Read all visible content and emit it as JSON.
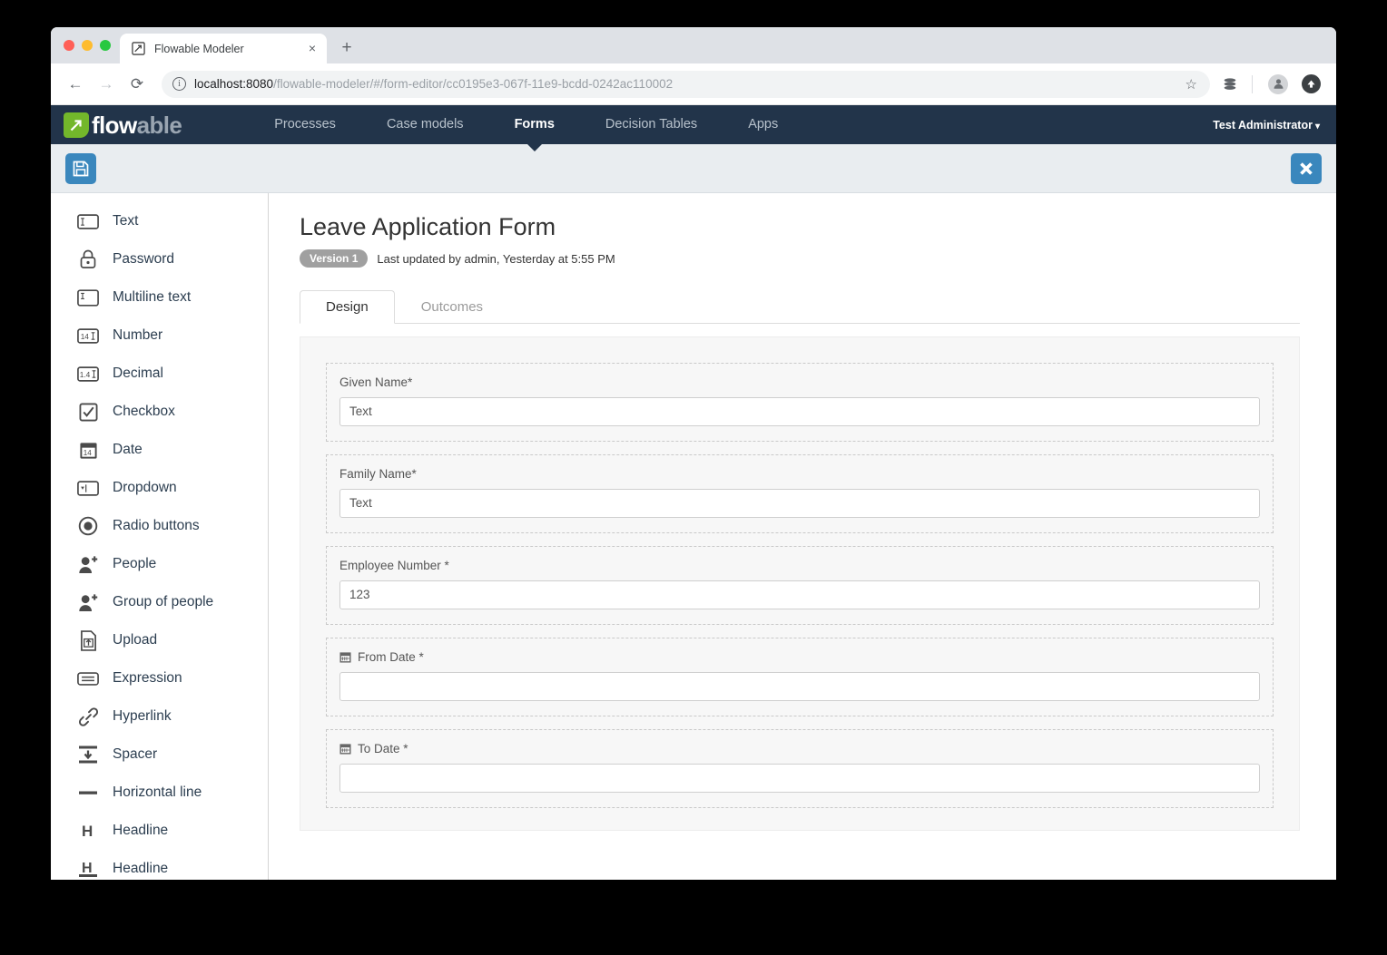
{
  "browser": {
    "tab_title": "Flowable Modeler",
    "tab_close_label": "×",
    "new_tab_label": "+",
    "back_label": "←",
    "forward_label": "→",
    "reload_label": "⟳",
    "url_host": "localhost:8080",
    "url_path": "/flowable-modeler/#/form-editor/cc0195e3-067f-11e9-bcdd-0242ac110002",
    "star_label": "☆"
  },
  "navbar": {
    "logo_text_primary": "flow",
    "logo_text_secondary": "able",
    "items": [
      {
        "label": "Processes",
        "active": false
      },
      {
        "label": "Case models",
        "active": false
      },
      {
        "label": "Forms",
        "active": true
      },
      {
        "label": "Decision Tables",
        "active": false
      },
      {
        "label": "Apps",
        "active": false
      }
    ],
    "user": "Test Administrator",
    "user_caret": "⌄",
    "background": "#22344a",
    "accent_green": "#73b72b"
  },
  "toolbar": {
    "save_icon": "save-icon",
    "close_icon": "close-icon",
    "button_color": "#3a87bd"
  },
  "palette": {
    "items": [
      {
        "label": "Text",
        "icon": "text-field-icon"
      },
      {
        "label": "Password",
        "icon": "lock-icon"
      },
      {
        "label": "Multiline text",
        "icon": "multiline-text-icon"
      },
      {
        "label": "Number",
        "icon": "number-field-icon"
      },
      {
        "label": "Decimal",
        "icon": "decimal-field-icon"
      },
      {
        "label": "Checkbox",
        "icon": "checkbox-icon"
      },
      {
        "label": "Date",
        "icon": "calendar-icon"
      },
      {
        "label": "Dropdown",
        "icon": "dropdown-icon"
      },
      {
        "label": "Radio buttons",
        "icon": "radio-button-icon"
      },
      {
        "label": "People",
        "icon": "person-add-icon"
      },
      {
        "label": "Group of people",
        "icon": "group-add-icon"
      },
      {
        "label": "Upload",
        "icon": "upload-file-icon"
      },
      {
        "label": "Expression",
        "icon": "expression-icon"
      },
      {
        "label": "Hyperlink",
        "icon": "link-icon"
      },
      {
        "label": "Spacer",
        "icon": "spacer-icon"
      },
      {
        "label": "Horizontal line",
        "icon": "horizontal-line-icon"
      },
      {
        "label": "Headline",
        "icon": "headline-icon"
      },
      {
        "label": "Headline",
        "icon": "headline-underline-icon"
      }
    ]
  },
  "form": {
    "title": "Leave Application Form",
    "version_badge": "Version 1",
    "meta": "Last updated by admin, Yesterday at 5:55 PM",
    "tabs": [
      {
        "label": "Design",
        "active": true
      },
      {
        "label": "Outcomes",
        "active": false
      }
    ],
    "fields": [
      {
        "label": "Given Name*",
        "value": "Text",
        "icon": null
      },
      {
        "label": "Family Name*",
        "value": "Text",
        "icon": null
      },
      {
        "label": "Employee Number *",
        "value": "123",
        "icon": null
      },
      {
        "label": "From Date *",
        "value": "",
        "icon": "calendar-icon"
      },
      {
        "label": "To Date *",
        "value": "",
        "icon": "calendar-icon"
      }
    ]
  }
}
